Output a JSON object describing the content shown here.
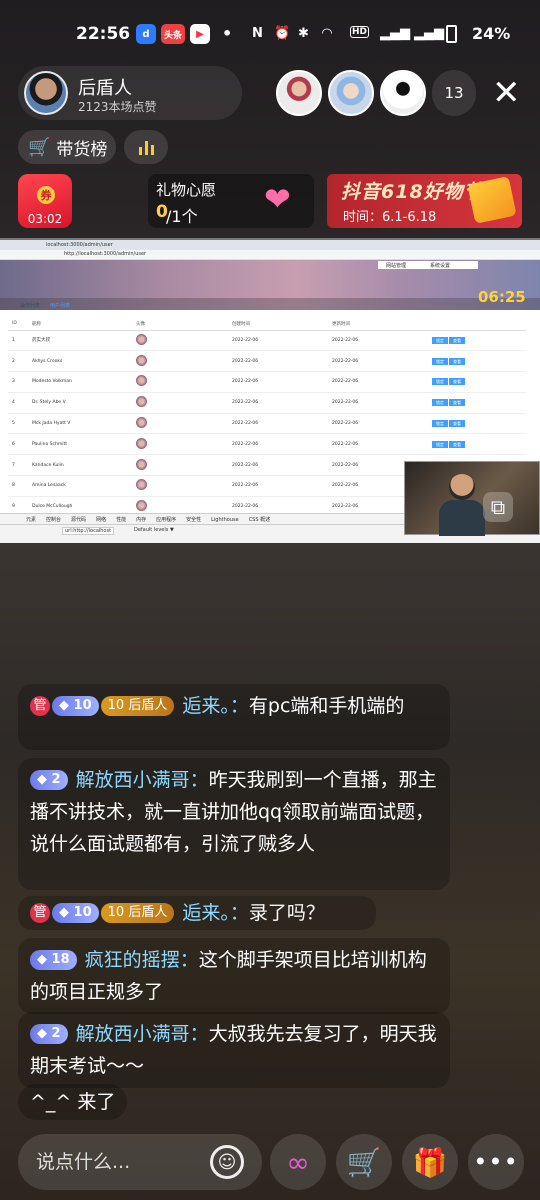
{
  "status_bar": {
    "time": "22:56",
    "apps": [
      {
        "icon": "browser-icon",
        "glyph": "d",
        "color": "#2f7bff"
      },
      {
        "icon": "toutiao-icon",
        "glyph": "头条",
        "color": "#f04142"
      },
      {
        "icon": "video-icon",
        "glyph": "▶",
        "color": "#ff3040"
      }
    ],
    "battery": "24%"
  },
  "host": {
    "name": "后盾人",
    "likes": "2123本场点赞"
  },
  "viewer_count": "13",
  "rank_label": "带货榜",
  "red_packet": {
    "timer": "03:02",
    "coin": "券"
  },
  "wish": {
    "title": "礼物心愿",
    "current": "0",
    "rest": "/1个"
  },
  "promo": {
    "title": "抖音618好物节",
    "date": "时间：6.1-6.18"
  },
  "screen": {
    "tab_text": "localhost:3000/admin/user",
    "url": "http://localhost:3000/admin/user",
    "banner_tabs": [
      "网站管理",
      "系统设置"
    ],
    "clock": "06:25",
    "admin_tabs": [
      "操作列表",
      "用户列表"
    ],
    "columns": [
      "ID",
      "昵称",
      "头像",
      "创建时间",
      "更新时间",
      ""
    ],
    "rows": [
      [
        "1",
        "药实大叔",
        "",
        "2022-22-06",
        "2022-22-06"
      ],
      [
        "2",
        "Akhys Crooks",
        "",
        "2022-22-06",
        "2022-22-06"
      ],
      [
        "3",
        "Modesto Volkman",
        "",
        "2022-22-06",
        "2022-22-06"
      ],
      [
        "4",
        "Dr. Stely Abe V",
        "",
        "2022-22-06",
        "2022-22-06"
      ],
      [
        "5",
        "Mck Jada Hyatt V",
        "",
        "2022-22-06",
        "2022-22-06"
      ],
      [
        "6",
        "Paulino Schmitt",
        "",
        "2022-22-06",
        "2022-22-06"
      ],
      [
        "7",
        "Kandace Kulin",
        "",
        "2022-22-06",
        "2022-22-06"
      ],
      [
        "8",
        "Amina Lesaack",
        "",
        "2022-22-06",
        "2022-22-06"
      ],
      [
        "9",
        "Dulce McCullough",
        "",
        "2022-22-06",
        "2022-22-06"
      ]
    ],
    "action_edit": "锁定",
    "action_view": "查看",
    "devtools_tabs": [
      "元素",
      "控制台",
      "源代码",
      "网络",
      "性能",
      "内存",
      "应用程序",
      "安全性",
      "Lighthouse",
      "CSS 概述"
    ],
    "devtools_filter": "url:http://localhost",
    "devtools_levels": "Default levels ▼"
  },
  "chat": [
    {
      "guan": "管",
      "level": "10",
      "fan": "后盾人",
      "nick": "逅来。",
      "text": "有pc端和手机端的"
    },
    {
      "guan": "",
      "level": "2",
      "fan": "",
      "nick": "解放西小满哥",
      "text": "昨天我刷到一个直播，那主播不讲技术，就一直讲加他qq领取前端面试题，说什么面试题都有，引流了贼多人"
    },
    {
      "guan": "管",
      "level": "10",
      "fan": "后盾人",
      "nick": "逅来。",
      "text": "录了吗？"
    },
    {
      "guan": "",
      "level": "18",
      "fan": "",
      "nick": "疯狂的摇摆",
      "text": "这个脚手架项目比培训机构的项目正规多了"
    },
    {
      "guan": "",
      "level": "2",
      "fan": "",
      "nick": "解放西小满哥",
      "text": "大叔我先去复习了，明天我期末考试～～"
    }
  ],
  "fan_level": "10",
  "colon": "：",
  "join_msg": "^_^ 来了",
  "input": {
    "placeholder": "说点什么..."
  },
  "bottom_buttons": [
    "link-icon",
    "cart-icon",
    "gift-icon",
    "more-icon"
  ]
}
